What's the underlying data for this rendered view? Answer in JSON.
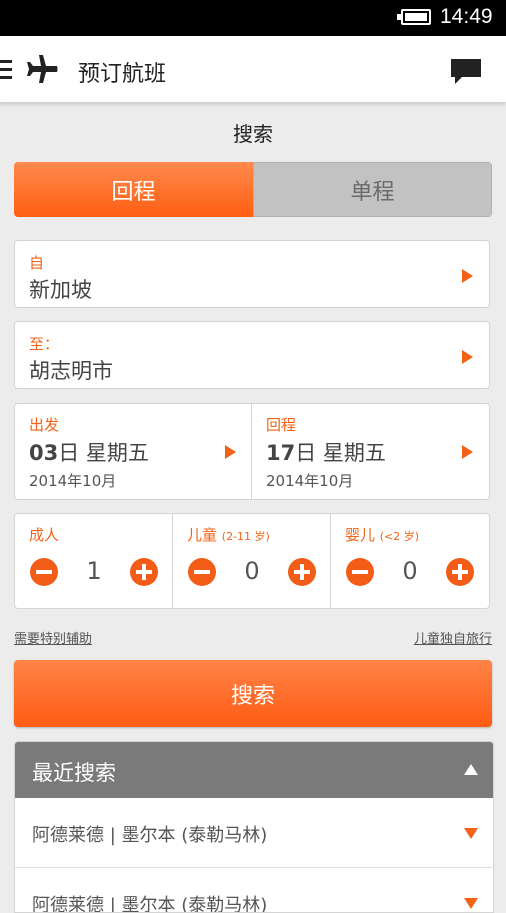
{
  "status_bar": {
    "time": "14:49"
  },
  "header": {
    "title": "预订航班"
  },
  "page": {
    "section_title": "搜索"
  },
  "trip_type": {
    "round_trip": "回程",
    "one_way": "单程"
  },
  "from": {
    "label": "自",
    "value": "新加坡"
  },
  "to": {
    "label": "至：",
    "value": "胡志明市"
  },
  "depart": {
    "label": "出发",
    "day": "03",
    "day_suffix": "日",
    "weekday": "星期五",
    "month": "2014年10月"
  },
  "return": {
    "label": "回程",
    "day": "17",
    "day_suffix": "日",
    "weekday": "星期五",
    "month": "2014年10月"
  },
  "passengers": {
    "adult": {
      "label": "成人",
      "note": "",
      "count": "1"
    },
    "child": {
      "label": "儿童",
      "note": "(2-11 岁)",
      "count": "0"
    },
    "infant": {
      "label": "婴儿",
      "note": "(<2 岁)",
      "count": "0"
    }
  },
  "links": {
    "special_assistance": "需要特别辅助",
    "unaccompanied_minor": "儿童独自旅行"
  },
  "search_button": "搜索",
  "recent": {
    "title": "最近搜索",
    "items": [
      "阿德莱德 | 墨尔本 (泰勒马林)",
      "阿德莱德 | 墨尔本 (泰勒马林)"
    ]
  },
  "colors": {
    "accent": "#f46315",
    "header_gray": "#7a7a7a"
  }
}
